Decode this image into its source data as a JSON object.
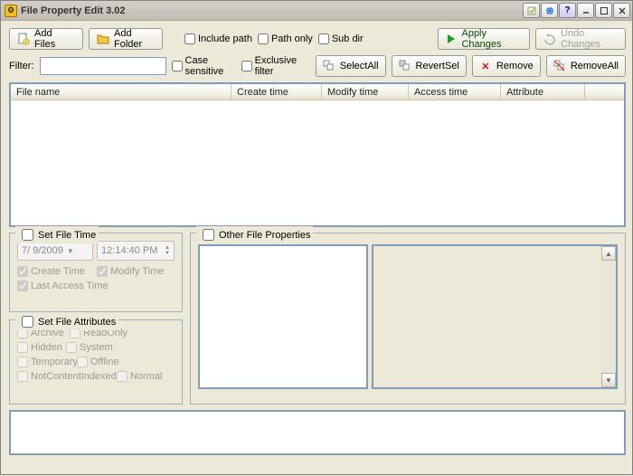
{
  "title": "File Property Edit  3.02",
  "toolbar1": {
    "add_files": "Add Files",
    "add_folder": "Add Folder",
    "include_path": "Include path",
    "path_only": "Path only",
    "sub_dir": "Sub dir",
    "apply_changes": "Apply Changes",
    "undo_changes": "Undo Changes"
  },
  "toolbar2": {
    "filter_label": "Filter:",
    "filter_value": "",
    "case_sensitive": "Case sensitive",
    "exclusive_filter": "Exclusive filter",
    "select_all": "SelectAll",
    "revert_sel": "RevertSel",
    "remove": "Remove",
    "remove_all": "RemoveAll"
  },
  "columns": {
    "file_name": "File name",
    "create_time": "Create time",
    "modify_time": "Modify time",
    "access_time": "Access time",
    "attribute": "Attribute"
  },
  "set_file_time": {
    "legend": "Set File Time",
    "date": "7/  9/2009",
    "time": "12:14:40 PM",
    "create_time": "Create Time",
    "modify_time": "Modify Time",
    "last_access_time": "Last Access Time"
  },
  "set_file_attr": {
    "legend": "Set File Attributes",
    "archive": "Archive",
    "readonly": "ReadOnly",
    "hidden": "Hidden",
    "system": "System",
    "temporary": "Temporary",
    "offline": "Offline",
    "notcontentindexed": "NotContentIndexed",
    "normal": "Normal"
  },
  "other_props": {
    "legend": "Other File Properties"
  }
}
